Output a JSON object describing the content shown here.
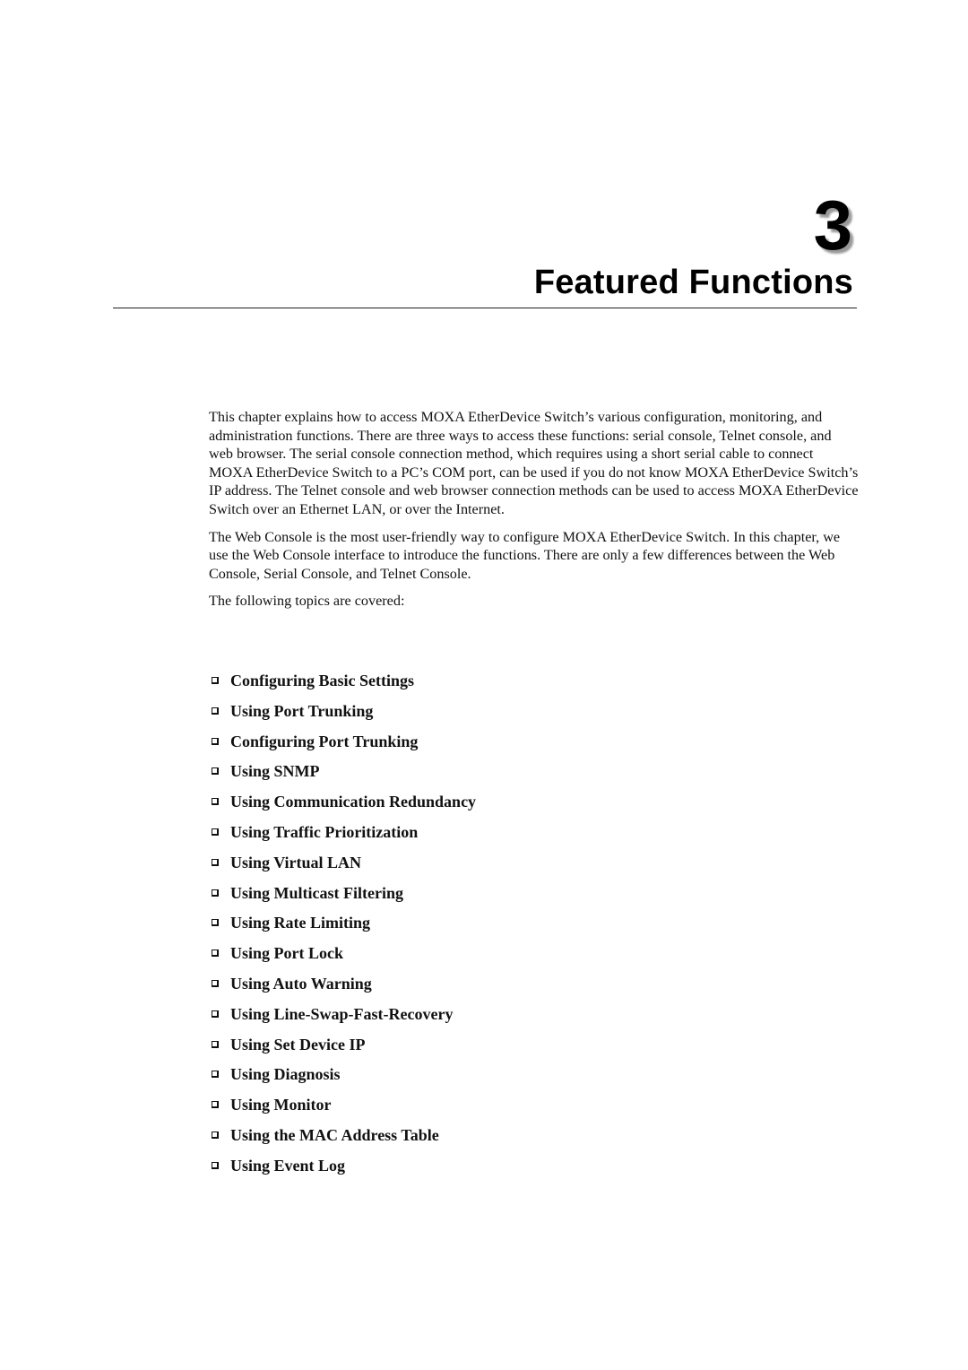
{
  "chapter": {
    "number": "3",
    "title": "Featured Functions"
  },
  "intro": {
    "paragraphs": [
      "This chapter explains how to access MOXA EtherDevice Switch’s various configuration, monitoring, and administration functions. There are three ways to access these functions: serial console, Telnet console, and web browser. The serial console connection method, which requires using a short serial cable to connect MOXA EtherDevice Switch to a PC’s COM port, can be used if you do not know MOXA EtherDevice Switch’s IP address. The Telnet console and web browser connection methods can be used to access MOXA EtherDevice Switch over an Ethernet LAN, or over the Internet.",
      "The Web Console is the most user-friendly way to configure MOXA EtherDevice Switch. In this chapter, we use the Web Console interface to introduce the functions. There are only a few differences between the Web Console, Serial Console, and Telnet Console.",
      "The following topics are covered:"
    ]
  },
  "topics": {
    "bullet_icon": "hollow-square-bullet",
    "items": [
      "Configuring Basic Settings",
      "Using Port Trunking",
      "Configuring Port Trunking",
      "Using SNMP",
      "Using Communication Redundancy",
      "Using Traffic Prioritization",
      "Using Virtual LAN",
      "Using Multicast Filtering",
      "Using Rate Limiting",
      "Using Port Lock",
      "Using Auto Warning",
      "Using Line-Swap-Fast-Recovery",
      "Using Set Device IP",
      "Using Diagnosis",
      "Using Monitor",
      "Using the MAC Address Table",
      "Using Event Log"
    ]
  }
}
